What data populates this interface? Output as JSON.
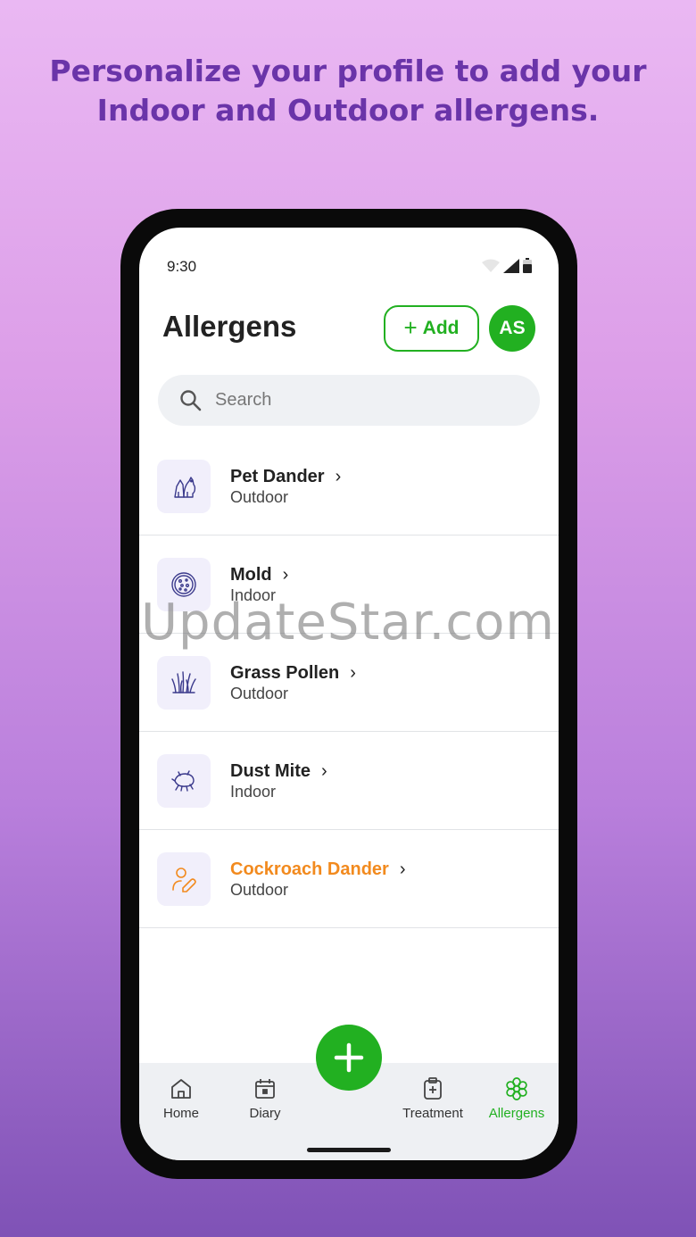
{
  "headline": {
    "line1": "Personalize your profile to add your",
    "line2": "Indoor and Outdoor allergens."
  },
  "status": {
    "time": "9:30"
  },
  "header": {
    "title": "Allergens",
    "add_label": "Add",
    "avatar_initials": "AS"
  },
  "search": {
    "placeholder": "Search"
  },
  "allergens": [
    {
      "name": "Pet Dander",
      "type": "Outdoor",
      "icon": "pet-icon"
    },
    {
      "name": "Mold",
      "type": "Indoor",
      "icon": "mold-icon"
    },
    {
      "name": "Grass Pollen",
      "type": "Outdoor",
      "icon": "grass-icon"
    },
    {
      "name": "Dust Mite",
      "type": "Indoor",
      "icon": "dust-mite-icon"
    },
    {
      "name": "Cockroach Dander",
      "type": "Outdoor",
      "icon": "custom-allergen-icon",
      "highlight_color": "#f28a1e"
    }
  ],
  "watermark": "UpdateStar.com",
  "nav": {
    "home": "Home",
    "diary": "Diary",
    "treatment": "Treatment",
    "allergens": "Allergens"
  },
  "colors": {
    "accent": "#22b021",
    "headline": "#6a34a9",
    "highlight": "#f28a1e"
  }
}
